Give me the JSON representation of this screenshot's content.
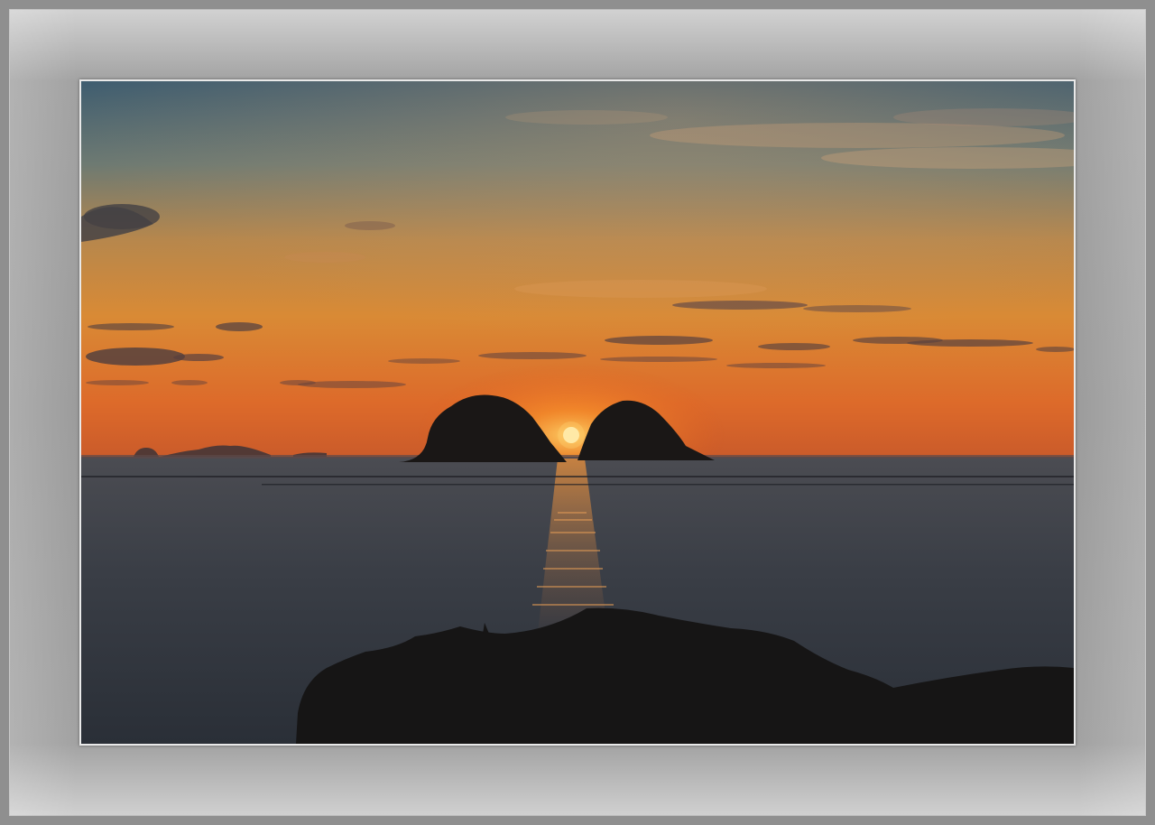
{
  "image": {
    "subject": "sunset-over-sea",
    "colors": {
      "sky_top": "#4a6576",
      "sky_mid": "#c9803f",
      "sky_horizon": "#e06a2a",
      "sun": "#fff6c4",
      "sea": "#3b3f46",
      "silhouette": "#1c1a1a",
      "frame": "#9a9a9a"
    }
  }
}
